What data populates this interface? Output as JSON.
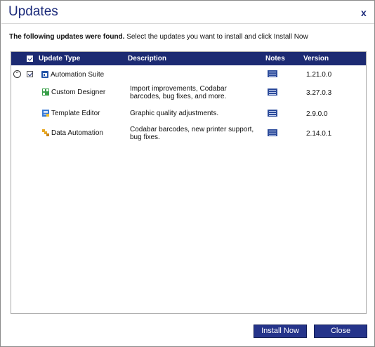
{
  "dialog": {
    "title": "Updates",
    "close_label": "x",
    "instruction_bold": "The following updates were found.",
    "instruction_rest": " Select the updates you want to install and click Install Now"
  },
  "table": {
    "headers": {
      "update_type": "Update Type",
      "description": "Description",
      "notes": "Notes",
      "version": "Version"
    },
    "parent": {
      "name": "Automation Suite",
      "version": "1.21.0.0",
      "checked": true,
      "expanded": true,
      "icon": "automation-suite-icon"
    },
    "children": [
      {
        "name": "Custom Designer",
        "description": "Import improvements, Codabar barcodes, bug fixes, and more.",
        "version": "3.27.0.3",
        "icon": "custom-designer-icon",
        "icon_color": "#3aa04a"
      },
      {
        "name": "Template Editor",
        "description": "Graphic quality adjustments.",
        "version": "2.9.0.0",
        "icon": "template-editor-icon",
        "icon_color": "#3a7bd5"
      },
      {
        "name": "Data Automation",
        "description": "Codabar barcodes, new printer support, bug fixes.",
        "version": "2.14.0.1",
        "icon": "data-automation-icon",
        "icon_color": "#e8a821"
      }
    ]
  },
  "buttons": {
    "install": "Install Now",
    "close": "Close"
  },
  "colors": {
    "header_bg": "#1c2a72",
    "button_bg": "#25348a",
    "title_color": "#1b2a7a"
  }
}
